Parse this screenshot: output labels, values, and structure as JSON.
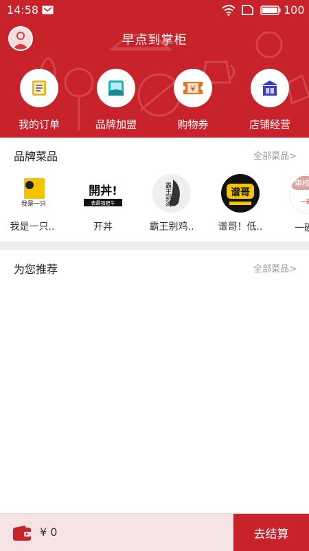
{
  "status_bar": {
    "time": "14:58",
    "battery": "100"
  },
  "header": {
    "title": "早点到掌柜"
  },
  "menu": [
    {
      "label": "我的订单",
      "icon": "order-list-icon"
    },
    {
      "label": "品牌加盟",
      "icon": "brand-join-icon"
    },
    {
      "label": "购物券",
      "icon": "coupon-icon"
    },
    {
      "label": "店铺经营",
      "icon": "store-manage-icon"
    }
  ],
  "brand_section": {
    "title": "品牌菜品",
    "more": "全部菜品>",
    "items": [
      {
        "name": "我是一只..",
        "logo_text": "我是一只"
      },
      {
        "name": "开丼",
        "logo_text": "開丼!",
        "logo_sub": "表最强肥牛"
      },
      {
        "name": "霸王别鸡..",
        "logo_text": "霸王别鸡"
      },
      {
        "name": "谱哥！低..",
        "logo_text": "谱哥"
      },
      {
        "name": "一碗小",
        "logo_text": "一碗小",
        "badge": "审核"
      }
    ]
  },
  "recommend_section": {
    "title": "为您推荐",
    "more": "全部菜品>"
  },
  "bottom_bar": {
    "balance": "¥ 0",
    "checkout": "去结算"
  },
  "colors": {
    "brand_red": "#c8222b",
    "icon_gold": "#f2b52a",
    "icon_teal": "#1fb0bd",
    "icon_purple": "#3a3fc2"
  }
}
